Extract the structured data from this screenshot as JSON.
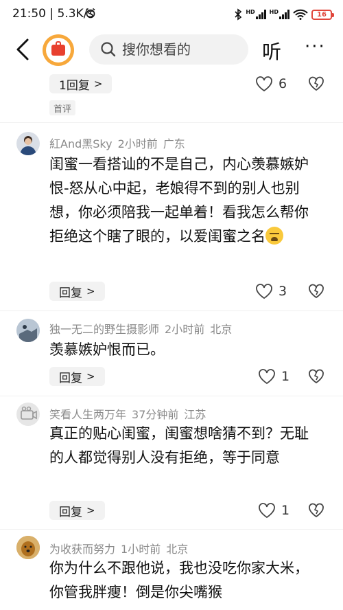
{
  "status": {
    "time": "21:50",
    "speed": "5.3K/s",
    "hd1": "HD",
    "hd2": "HD",
    "battery": "16"
  },
  "nav": {
    "search_placeholder": "搜你想看的",
    "listen_label": "听",
    "more_label": "···"
  },
  "top_comment": {
    "reply_label": "1回复",
    "likes": "6",
    "tag": "首评"
  },
  "comments": [
    {
      "username": "紅And黑Sky",
      "time": "2小时前",
      "location": "广东",
      "text": "闺蜜一看搭讪的不是自己，内心羡慕嫉妒恨-怒从心中起，老娘得不到的别人也别想，你必须陪我一起单着！看我怎么帮你拒绝这个瞎了眼的，以爱闺蜜之名",
      "reply_label": "回复",
      "likes": "3"
    },
    {
      "username": "独一无二的野生摄影师",
      "time": "2小时前",
      "location": "北京",
      "text": "羡慕嫉妒恨而已。",
      "reply_label": "回复",
      "likes": "1"
    },
    {
      "username": "笑看人生两万年",
      "time": "37分钟前",
      "location": "江苏",
      "text": "真正的贴心闺蜜，闺蜜想啥猜不到？无耻的人都觉得别人没有拒绝，等于同意",
      "reply_label": "回复",
      "likes": "1"
    },
    {
      "username": "为收获而努力",
      "time": "1小时前",
      "location": "北京",
      "text": "你为什么不跟他说，我也没吃你家大米，你管我胖瘦！倒是你尖嘴猴"
    }
  ]
}
